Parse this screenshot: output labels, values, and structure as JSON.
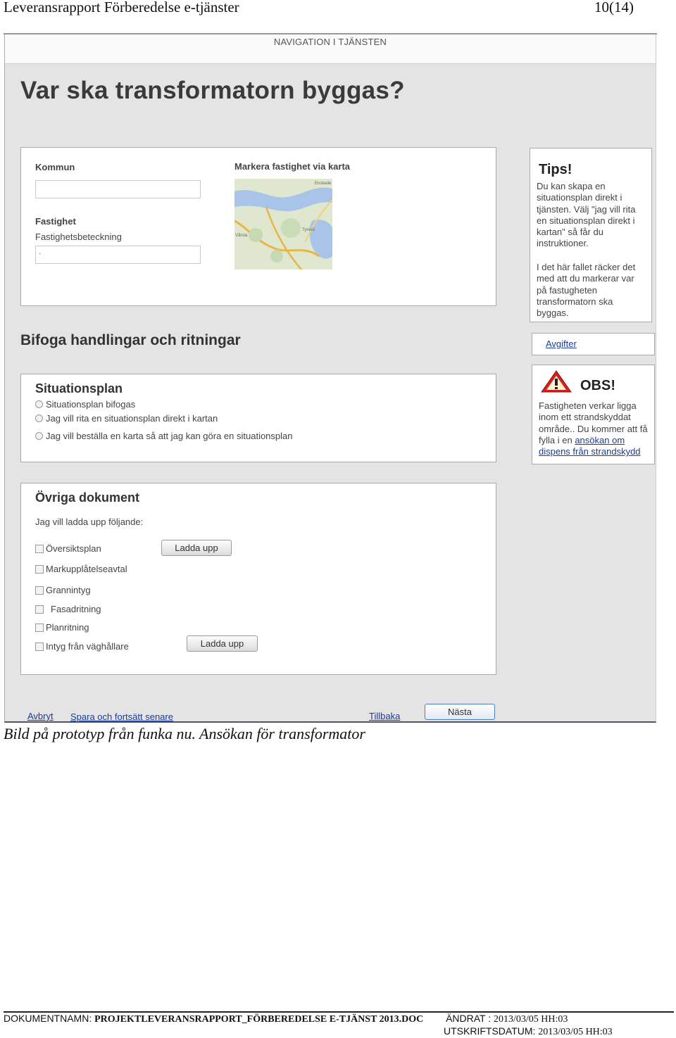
{
  "document": {
    "title": "Leveransrapport Förberedelse e-tjänster",
    "page": "10(14)",
    "caption": "Bild på prototyp från funka nu. Ansökan för transformator"
  },
  "app": {
    "nav_label": "NAVIGATION I TJÄNSTEN",
    "main_title": "Var ska transformatorn byggas?",
    "location": {
      "kommun_label": "Kommun",
      "kommun_value": "",
      "fastighet_label": "Fastighet",
      "fastighetsbeteckning_label": "Fastighetsbeteckning",
      "fastighetsbeteckning_value": ".",
      "map_label": "Markera fastighet via karta",
      "map_places": [
        "Enskede",
        "Tyresö",
        "Vårsta"
      ]
    },
    "tips": {
      "heading": "Tips!",
      "text1": "Du kan skapa en situationsplan direkt i tjänsten. Välj \"jag vill rita en situationsplan direkt i kartan\" så får du instruktioner.",
      "text2": "I det här fallet räcker det med att du markerar var på fastugheten transformatorn ska byggas."
    },
    "avgifter_link": "Avgifter",
    "obs": {
      "heading": "OBS!",
      "text": "Fastigheten verkar ligga inom ett strandskyddat område.. Du kommer att få fylla i en",
      "link": "ansökan om dispens från strandskydd"
    },
    "attach_heading": "Bifoga handlingar och ritningar",
    "situationsplan": {
      "heading": "Situationsplan",
      "options": [
        "Situationsplan bifogas",
        "Jag vill rita en situationsplan direkt i kartan",
        "Jag vill beställa en karta så att jag kan göra en situationsplan"
      ]
    },
    "ovriga": {
      "heading": "Övriga dokument",
      "intro": "Jag vill ladda upp följande:",
      "items": [
        "Översiktsplan",
        "Markupplåtelseavtal",
        "Grannintyg",
        "Fasadritning",
        "Planritning",
        "Intyg från väghållare"
      ],
      "upload_label": "Ladda upp"
    },
    "footer": {
      "avbryt": "Avbryt",
      "spara": "Spara och fortsätt senare",
      "tillbaka": "Tillbaka",
      "nasta": "Nästa"
    }
  },
  "doc_footer": {
    "name_label": "DOKUMENTNAMN:",
    "name_value": "PROJEKTLEVERANSRAPPORT_FÖRBEREDELSE E-TJÄNST 2013.DOC",
    "changed_label": "ÄNDRAT :",
    "changed_value": "2013/03/05 HH:03",
    "print_label": "UTSKRIFTSDATUM:",
    "print_value": "2013/03/05 HH:03"
  },
  "colors": {
    "screen_bg": "#e4e4e4",
    "link": "#1a3c9a",
    "warning": "#d62020"
  }
}
